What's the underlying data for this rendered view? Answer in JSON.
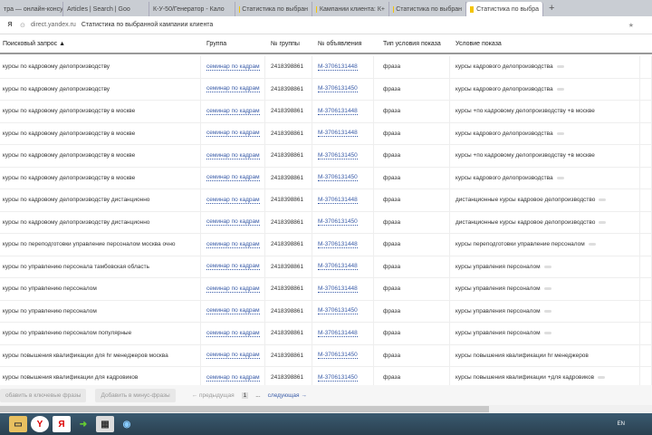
{
  "tabs": [
    "тра — онлайн-консу",
    "Articles | Search | Goo",
    "К-У-50/Генератор - Кало",
    "Статистика по выбран",
    "Кампании клиента: К+",
    "Статистика по выбран",
    "Статистика по выбра"
  ],
  "address": {
    "domain": "direct.yandex.ru",
    "title": "Статистика по выбранной кампании клиента"
  },
  "headers": [
    "Поисковый запрос ▲",
    "Группа",
    "№ группы",
    "№ объявления",
    "Тип условия показа",
    "Условие показа"
  ],
  "rows": [
    [
      "курсы по кадровому делопроизводству",
      "семинар по кадрам",
      "2418398861",
      "M-3706131448",
      "фраза",
      "курсы кадрового делопроизводства"
    ],
    [
      "курсы по кадровому делопроизводству",
      "семинар по кадрам",
      "2418398861",
      "M-3706131450",
      "фраза",
      "курсы кадрового делопроизводства"
    ],
    [
      "курсы по кадровому делопроизводству в москве",
      "семинар по кадрам",
      "2418398861",
      "M-3706131448",
      "фраза",
      "курсы +по кадровому делопроизводству +в москве"
    ],
    [
      "курсы по кадровому делопроизводству в москве",
      "семинар по кадрам",
      "2418398861",
      "M-3706131448",
      "фраза",
      "курсы кадрового делопроизводства"
    ],
    [
      "курсы по кадровому делопроизводству в москве",
      "семинар по кадрам",
      "2418398861",
      "M-3706131450",
      "фраза",
      "курсы +по кадровому делопроизводству +в москве"
    ],
    [
      "курсы по кадровому делопроизводству в москве",
      "семинар по кадрам",
      "2418398861",
      "M-3706131450",
      "фраза",
      "курсы кадрового делопроизводства"
    ],
    [
      "курсы по кадровому делопроизводству дистанционно",
      "семинар по кадрам",
      "2418398861",
      "M-3706131448",
      "фраза",
      "дистанционные курсы кадровое делопроизводство"
    ],
    [
      "курсы по кадровому делопроизводству дистанционно",
      "семинар по кадрам",
      "2418398861",
      "M-3706131450",
      "фраза",
      "дистанционные курсы кадровое делопроизводство"
    ],
    [
      "курсы по переподготовки управление персоналом москва очно",
      "семинар по кадрам",
      "2418398861",
      "M-3706131448",
      "фраза",
      "курсы переподготовки управление персоналом"
    ],
    [
      "курсы по управлению персонала тамбовская область",
      "семинар по кадрам",
      "2418398861",
      "M-3706131448",
      "фраза",
      "курсы управления персоналом"
    ],
    [
      "курсы по управлению персоналом",
      "семинар по кадрам",
      "2418398861",
      "M-3706131448",
      "фраза",
      "курсы управления персоналом"
    ],
    [
      "курсы по управлению персоналом",
      "семинар по кадрам",
      "2418398861",
      "M-3706131450",
      "фраза",
      "курсы управления персоналом"
    ],
    [
      "курсы по управлению персоналом популярные",
      "семинар по кадрам",
      "2418398861",
      "M-3706131448",
      "фраза",
      "курсы управления персоналом"
    ],
    [
      "курсы повышения квалификации для hr менеджеров москва",
      "семинар по кадрам",
      "2418398861",
      "M-3706131450",
      "фраза",
      "курсы повышения квалификации hr менеджеров"
    ],
    [
      "курсы повышения квалификации для кадровиков",
      "семинар по кадрам",
      "2418398861",
      "M-3706131450",
      "фраза",
      "курсы повышения квалификации +для кадровиков"
    ]
  ],
  "dots": [
    true,
    true,
    false,
    true,
    false,
    true,
    true,
    true,
    true,
    true,
    true,
    true,
    true,
    false,
    true
  ],
  "footer": {
    "add_keywords": "обавить в ключевые фразы",
    "add_minus": "Добавить в минус-фразы",
    "prev": "← предыдущая",
    "page": "1",
    "ellipsis": "...",
    "next": "следующая →"
  },
  "tray": {
    "lang": "EN"
  }
}
